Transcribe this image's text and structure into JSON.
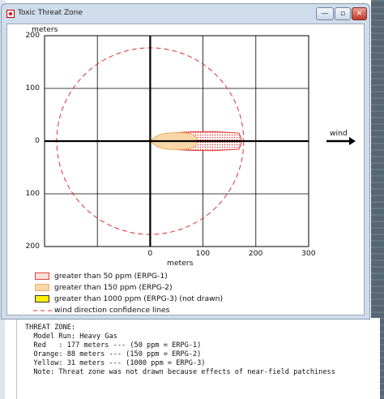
{
  "window": {
    "title": "Toxic Threat Zone",
    "minimize_glyph": "—",
    "maximize_glyph": "▫",
    "close_glyph": "✕"
  },
  "chart_data": {
    "type": "threat-zone-plot",
    "y_axis_unit": "meters",
    "x_axis_unit": "meters",
    "x_ticks": [
      "0",
      "100",
      "200",
      "300"
    ],
    "x_range": [
      -200,
      300
    ],
    "y_ticks_top_to_bottom": [
      "200",
      "100",
      "0",
      "100",
      "200"
    ],
    "y_range": [
      -200,
      200
    ],
    "grid": true,
    "wind_label": "wind",
    "wind_direction": "east",
    "zones": [
      {
        "name": "greater than 50 ppm (ERPG-1)",
        "color": "#e03030",
        "downwind_m": 177,
        "max_half_width_m": 18,
        "pattern": "dotted"
      },
      {
        "name": "greater than 150 ppm (ERPG-2)",
        "color": "#f3b06a",
        "downwind_m": 88,
        "max_half_width_m": 16,
        "pattern": "solid"
      },
      {
        "name": "greater than 1000 ppm (ERPG-3) (not drawn)",
        "color": "#ffee00",
        "downwind_m": 31,
        "pattern": "none"
      }
    ],
    "confidence_circle_radius_m": 177
  },
  "legend": [
    {
      "label": "greater than 50 ppm (ERPG-1)",
      "icon": "red-dotted-swatch"
    },
    {
      "label": "greater than 150 ppm (ERPG-2)",
      "icon": "orange-swatch"
    },
    {
      "label": "greater than 1000 ppm (ERPG-3) (not drawn)",
      "icon": "yellow-swatch"
    },
    {
      "label": "wind direction confidence lines",
      "icon": "red-dashed-line"
    }
  ],
  "text_panel": [
    "THREAT ZONE:",
    "  Model Run: Heavy Gas",
    "  Red   : 177 meters --- (50 ppm = ERPG-1)",
    "  Orange: 88 meters --- (150 ppm = ERPG-2)",
    "  Yellow: 31 meters --- (1000 ppm = ERPG-3)",
    "  Note: Threat zone was not drawn because effects of near-field patchiness"
  ]
}
